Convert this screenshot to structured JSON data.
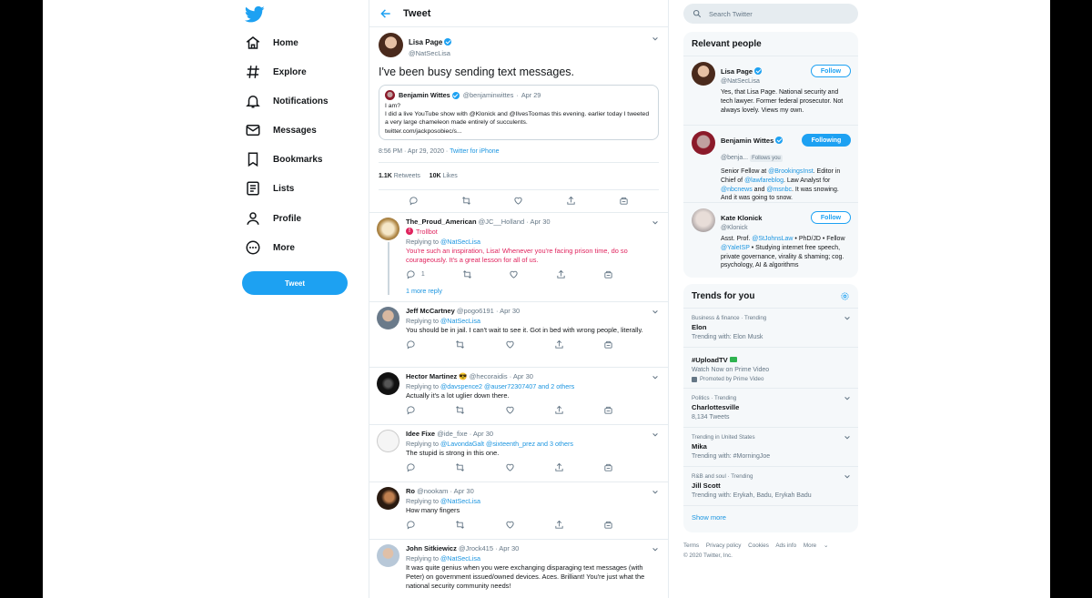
{
  "nav": {
    "items": [
      {
        "label": "Home",
        "icon": "home-icon"
      },
      {
        "label": "Explore",
        "icon": "hashtag-icon"
      },
      {
        "label": "Notifications",
        "icon": "bell-icon"
      },
      {
        "label": "Messages",
        "icon": "envelope-icon"
      },
      {
        "label": "Bookmarks",
        "icon": "bookmark-icon"
      },
      {
        "label": "Lists",
        "icon": "list-icon"
      },
      {
        "label": "Profile",
        "icon": "person-icon"
      },
      {
        "label": "More",
        "icon": "more-circle-icon"
      }
    ],
    "tweet_button": "Tweet"
  },
  "header": {
    "title": "Tweet"
  },
  "main_tweet": {
    "name": "Lisa Page",
    "handle": "@NatSecLisa",
    "text": "I've been busy sending text messages.",
    "quote": {
      "name": "Benjamin Wittes",
      "handle": "@benjaminwittes",
      "sep": "·",
      "date": "Apr 29",
      "line1": "I am?",
      "line2": "I did a live YouTube show with @Klonick and @IlvesToomas this evening. earlier today I tweeted a very large chameleon made entirely of succulents.",
      "link": "twitter.com/jackposobiec/s..."
    },
    "time": "8:56 PM · Apr 29, 2020 · ",
    "source": "Twitter for iPhone",
    "retweets_count": "1.1K",
    "retweets_label": "Retweets",
    "likes_count": "10K",
    "likes_label": "Likes"
  },
  "replies": [
    {
      "name": "The_Proud_American",
      "handle": "@JC__Holland",
      "date": "· Apr 30",
      "badge": "Trollbot",
      "replying_prefix": "Replying to ",
      "replying_to": "@NatSecLisa",
      "text": "You're such an inspiration, Lisa! Whenever you're facing prison time, do so courageously. It's a great lesson for all of us.",
      "reply_count": "1",
      "more": "1 more reply"
    },
    {
      "name": "Jeff McCartney",
      "handle": "@pogo6191",
      "date": "· Apr 30",
      "replying_prefix": "Replying to ",
      "replying_to": "@NatSecLisa",
      "text": "You should be in jail. I can't wait to see it. Got in bed with wrong people, literally."
    },
    {
      "name": "Hector Martinez",
      "emoji": "😎",
      "handle": "@hecoraidis",
      "date": "· Apr 30",
      "replying_prefix": "Replying to ",
      "replying_to": "@davspence2 @auser72307407 and 2 others",
      "text": "Actually it's a lot uglier down there."
    },
    {
      "name": "Idee Fixe",
      "handle": "@ide_fixe",
      "date": "· Apr 30",
      "replying_prefix": "Replying to ",
      "replying_to": "@LavondaGalt @sixteenth_prez and 3 others",
      "text": "The stupid is strong in this one."
    },
    {
      "name": "Ro",
      "handle": "@nookam",
      "date": "· Apr 30",
      "replying_prefix": "Replying to ",
      "replying_to": "@NatSecLisa",
      "text": "How many fingers"
    },
    {
      "name": "John Sitkiewicz",
      "handle": "@Jrock415",
      "date": "· Apr 30",
      "replying_prefix": "Replying to ",
      "replying_to": "@NatSecLisa",
      "text": "It was quite genius when you were exchanging disparaging text messages (with Peter) on government issued/owned devices. Aces. Brilliant! You're just what the national security community needs!"
    }
  ],
  "search": {
    "placeholder": "Search Twitter"
  },
  "relevant": {
    "title": "Relevant people",
    "people": [
      {
        "name": "Lisa Page",
        "handle": "@NatSecLisa",
        "button": "Follow",
        "bio": "Yes, that Lisa Page. National security and tech lawyer. Former federal prosecutor. Not always lovely. Views my own."
      },
      {
        "name": "Benjamin Wittes",
        "handle": "@benja...",
        "follows_you": "Follows you",
        "button": "Following",
        "bio_a": "Senior Fellow at ",
        "bio_b": "@BrookingsInst",
        "bio_c": ". Editor in Chief of ",
        "bio_d": "@lawfareblog",
        "bio_e": ". Law Analyst for ",
        "bio_f": "@nbcnews",
        "bio_g": " and ",
        "bio_h": "@msnbc",
        "bio_i": ". It was snowing. And it was going to snow."
      },
      {
        "name": "Kate Klonick",
        "handle": "@Klonick",
        "button": "Follow",
        "bio_a": "Asst. Prof. ",
        "bio_b": "@StJohnsLaw",
        "bio_c": " • PhD/JD • Fellow ",
        "bio_d": "@YaleISP",
        "bio_e": " • Studying internet free speech, private governance, virality & shaming; cog. psychology, AI & algorithms"
      }
    ]
  },
  "trends": {
    "title": "Trends for you",
    "items": [
      {
        "category": "Business & finance · Trending",
        "name": "Elon",
        "sub": "Trending with: Elon Musk"
      },
      {
        "category": "",
        "name": "#UploadTV",
        "sub": "Watch Now on Prime Video",
        "promoted": "Promoted by Prime Video"
      },
      {
        "category": "Politics · Trending",
        "name": "Charlottesville",
        "sub": "8,134 Tweets"
      },
      {
        "category": "Trending in United States",
        "name": "Mika",
        "sub": "Trending with: #MorningJoe"
      },
      {
        "category": "R&B and soul · Trending",
        "name": "Jill Scott",
        "sub": "Trending with: Erykah, Badu, Erykah Badu"
      }
    ],
    "show_more": "Show more"
  },
  "footer": {
    "links": [
      "Terms",
      "Privacy policy",
      "Cookies",
      "Ads info",
      "More"
    ],
    "copyright": "© 2020 Twitter, Inc."
  },
  "colors": {
    "accent": "#1da1f2",
    "trollbot": "#e0245e",
    "secondary": "#657786"
  }
}
